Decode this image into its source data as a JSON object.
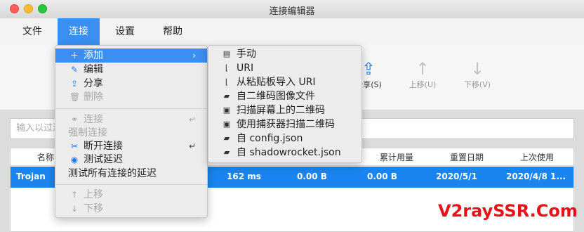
{
  "window": {
    "title": "连接编辑器"
  },
  "menubar": [
    {
      "label": "文件"
    },
    {
      "label": "连接"
    },
    {
      "label": "设置"
    },
    {
      "label": "帮助"
    }
  ],
  "toolbar": {
    "share": "分享(S)",
    "move_up": "上移(U)",
    "move_down": "下移(V)"
  },
  "search": {
    "placeholder": "输入以过滤"
  },
  "table": {
    "headers": [
      "名称",
      "累计用量",
      "重置日期",
      "上次使用"
    ],
    "row": {
      "name": "Trojan",
      "latency": "162 ms",
      "usage1": "0.00 B",
      "usage2": "0.00 B",
      "reset": "2020/5/1",
      "last_used": "2020/4/8 1..."
    }
  },
  "connection_menu": {
    "add": "添加",
    "edit": "编辑",
    "share": "分享",
    "delete": "删除",
    "connect": "连接",
    "connect_shortcut": "↵",
    "force_connect": "强制连接",
    "disconnect": "断开连接",
    "disconnect_shortcut": "↵",
    "test_latency": "测试延迟",
    "test_all": "测试所有连接的延迟",
    "move_up": "上移",
    "move_down": "下移"
  },
  "add_submenu": [
    {
      "label": "手动",
      "icon": "manual-icon"
    },
    {
      "label": "URI",
      "icon": "uri-icon"
    },
    {
      "label": "从粘贴板导入 URI",
      "icon": "clipboard-icon"
    },
    {
      "label": "自二维码图像文件",
      "icon": "folder-icon"
    },
    {
      "label": "扫描屏幕上的二维码",
      "icon": "qrcode-icon"
    },
    {
      "label": "使用捕获器扫描二维码",
      "icon": "qrcode-icon"
    },
    {
      "label": "自 config.json",
      "icon": "folder-icon"
    },
    {
      "label": "自 shadowrocket.json",
      "icon": "folder-icon"
    }
  ],
  "watermark": "V2raySSR.Com",
  "colors": {
    "accent": "#3b8ff0",
    "selection": "#1a85f0",
    "watermark": "#e8111a"
  }
}
